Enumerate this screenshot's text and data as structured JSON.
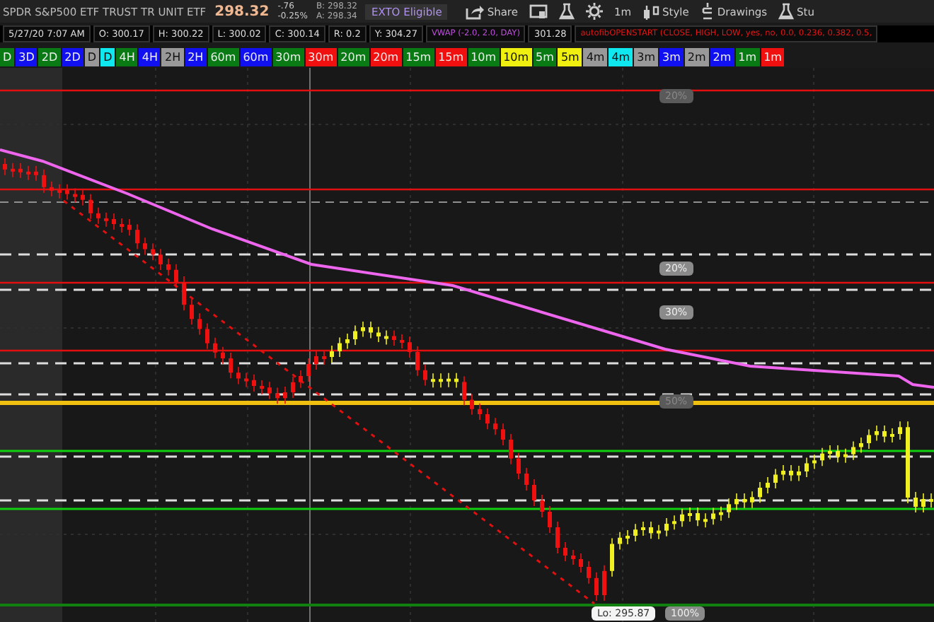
{
  "header": {
    "symbol": "SPDR S&P500 ETF TRUST TR UNIT ETF",
    "price": "298.32",
    "change": "-.76",
    "change_pct": "-0.25%",
    "bid": "B: 298.32",
    "ask": "A: 298.34",
    "badge": "EXTO Eligible"
  },
  "toolbar": [
    {
      "kind": "share",
      "label": "Share"
    },
    {
      "kind": "screen"
    },
    {
      "kind": "flask"
    },
    {
      "kind": "gear"
    },
    {
      "kind": "plain",
      "label": "1m"
    },
    {
      "kind": "style",
      "label": "Style"
    },
    {
      "kind": "drawings",
      "label": "Drawings"
    },
    {
      "kind": "flask",
      "label": "Stu"
    }
  ],
  "quote_bar": [
    "5/27/20 7:07 AM",
    "O: 300.17",
    "H: 300.22",
    "L: 300.02",
    "C: 300.14",
    "R: 0.2",
    "Y: 304.27"
  ],
  "studies": [
    {
      "label": "VWAP (-2.0, 2.0, DAY)",
      "color": "#c050e0",
      "value": "301.28"
    },
    {
      "label": "autofibOPENSTART (CLOSE, HIGH, LOW, yes, no, 0.0, 0.236, 0.382, 0.5,",
      "color": "#e01818"
    }
  ],
  "timeframes": [
    {
      "label": "D",
      "color": "#0a7a14"
    },
    {
      "label": "3D",
      "color": "#1010f0"
    },
    {
      "label": "2D",
      "color": "#0a7a14"
    },
    {
      "label": "2D",
      "color": "#1010f0"
    },
    {
      "label": "D",
      "color": "#999999"
    },
    {
      "label": "D",
      "color": "#10e8f0"
    },
    {
      "label": "4H",
      "color": "#0a7a14"
    },
    {
      "label": "4H",
      "color": "#1010f0"
    },
    {
      "label": "2H",
      "color": "#999999"
    },
    {
      "label": "2H",
      "color": "#1010f0"
    },
    {
      "label": "60m",
      "color": "#0a7a14"
    },
    {
      "label": "60m",
      "color": "#1010f0"
    },
    {
      "label": "30m",
      "color": "#0a7a14"
    },
    {
      "label": "30m",
      "color": "#f01010"
    },
    {
      "label": "20m",
      "color": "#0a7a14"
    },
    {
      "label": "20m",
      "color": "#f01010"
    },
    {
      "label": "15m",
      "color": "#0a7a14"
    },
    {
      "label": "15m",
      "color": "#f01010"
    },
    {
      "label": "10m",
      "color": "#0a7a14"
    },
    {
      "label": "10m",
      "color": "#f0f010"
    },
    {
      "label": "5m",
      "color": "#0a7a14"
    },
    {
      "label": "5m",
      "color": "#f0f010"
    },
    {
      "label": "4m",
      "color": "#999999"
    },
    {
      "label": "4m",
      "color": "#10e8f0"
    },
    {
      "label": "3m",
      "color": "#999999"
    },
    {
      "label": "3m",
      "color": "#1010f0"
    },
    {
      "label": "2m",
      "color": "#999999"
    },
    {
      "label": "2m",
      "color": "#1010f0"
    },
    {
      "label": "1m",
      "color": "#0a7a14"
    },
    {
      "label": "1m",
      "color": "#f01010"
    }
  ],
  "chart": {
    "level_bubbles": [
      {
        "text": "20%",
        "faded": true
      },
      {
        "text": "20%",
        "faded": false
      },
      {
        "text": "30%",
        "faded": false
      },
      {
        "text": "50%",
        "faded": true
      },
      {
        "text": "100%",
        "faded": false
      }
    ],
    "low_label": "Lo: 295.87"
  }
}
